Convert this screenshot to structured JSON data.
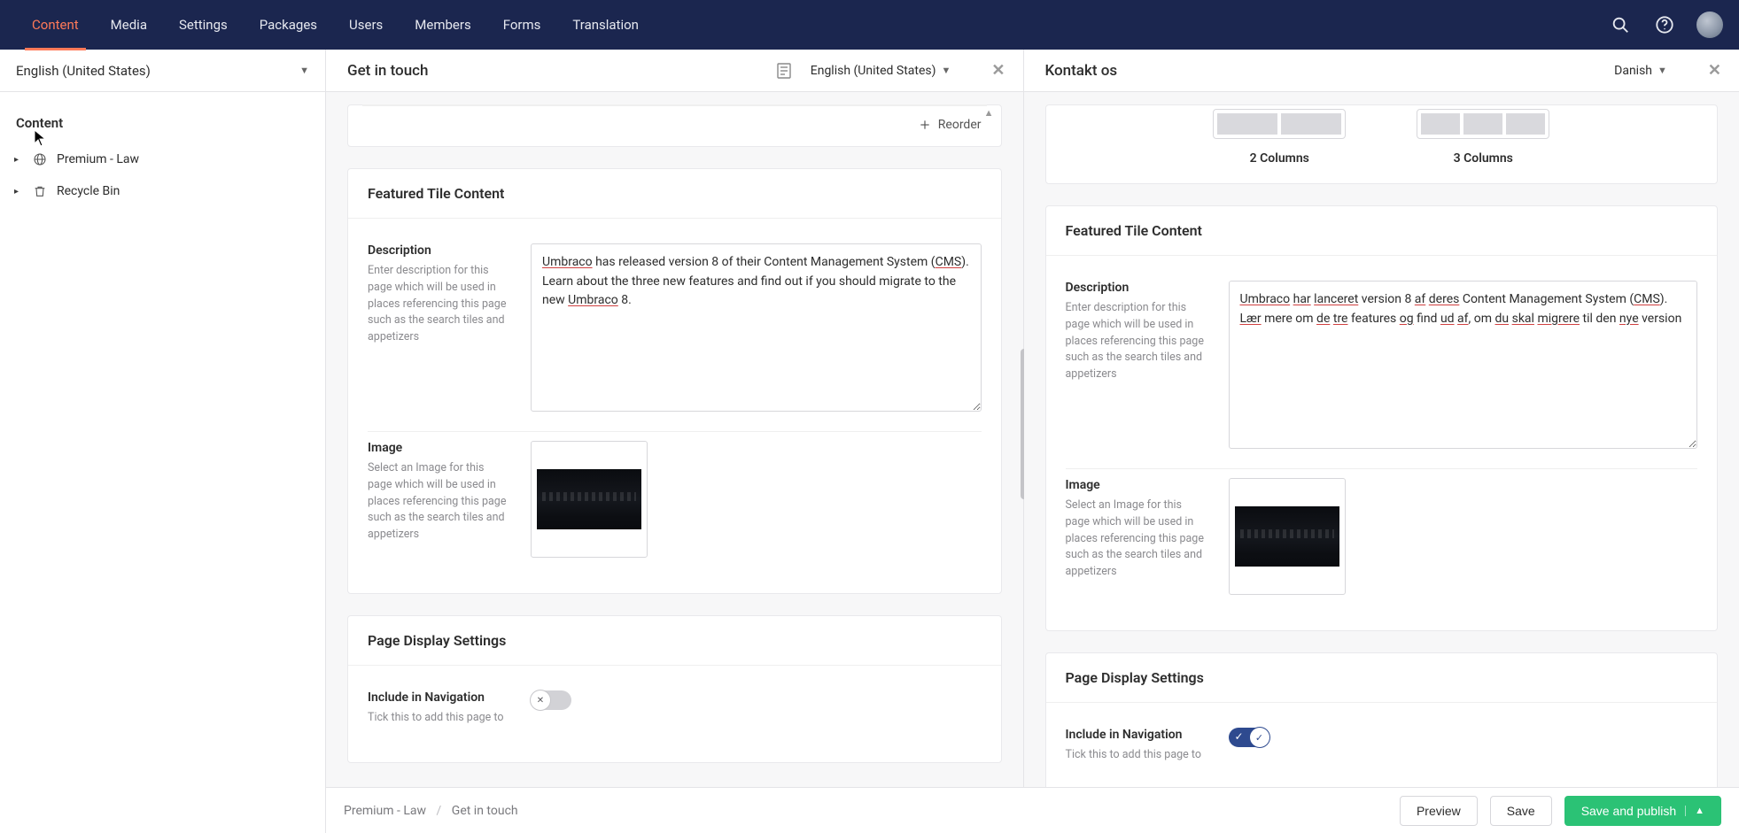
{
  "topnav": {
    "items": [
      "Content",
      "Media",
      "Settings",
      "Packages",
      "Users",
      "Members",
      "Forms",
      "Translation"
    ],
    "active_index": 0
  },
  "sidebar": {
    "language": "English (United States)",
    "section_label": "Content",
    "tree": [
      {
        "icon": "globe",
        "label": "Premium - Law"
      },
      {
        "icon": "trash",
        "label": "Recycle Bin"
      }
    ]
  },
  "panels": {
    "left": {
      "title": "Get in touch",
      "lang": "English (United States)",
      "reorder_label": "Reorder",
      "featured_tile_heading": "Featured Tile Content",
      "description": {
        "label": "Description",
        "help": "Enter description for this page which will be used in places referencing this page such as the search tiles and appetizers",
        "value_prefix1": "Umbraco",
        "value_mid1": " has released version 8 of their Content Management System (",
        "value_cms": "CMS",
        "value_mid2": "). Learn about the three new features and find out if you should migrate to the new ",
        "value_prefix2": "Umbraco",
        "value_suffix": " 8."
      },
      "image": {
        "label": "Image",
        "help": "Select an Image for this page which will be used in places referencing this page such as the search tiles and appetizers"
      },
      "page_display_heading": "Page Display Settings",
      "include_nav": {
        "label": "Include in Navigation",
        "help": "Tick this to add this page to",
        "value": false
      }
    },
    "right": {
      "title": "Kontakt os",
      "lang": "Danish",
      "layouts": [
        {
          "cols": 2,
          "label": "2 Columns"
        },
        {
          "cols": 3,
          "label": "3 Columns"
        }
      ],
      "featured_tile_heading": "Featured Tile Content",
      "description": {
        "label": "Description",
        "help": "Enter description for this page which will be used in places referencing this page such as the search tiles and appetizers",
        "segments": [
          {
            "t": "Umbraco",
            "u": true
          },
          {
            "t": " "
          },
          {
            "t": "har",
            "u": true
          },
          {
            "t": " "
          },
          {
            "t": "lanceret",
            "u": true
          },
          {
            "t": " version 8 "
          },
          {
            "t": "af",
            "u": true
          },
          {
            "t": " "
          },
          {
            "t": "deres",
            "u": true
          },
          {
            "t": " Content Management System ("
          },
          {
            "t": "CMS",
            "u": true
          },
          {
            "t": "). "
          },
          {
            "t": "Lær",
            "u": true
          },
          {
            "t": " mere om "
          },
          {
            "t": "de",
            "u": true
          },
          {
            "t": " "
          },
          {
            "t": "tre",
            "u": true
          },
          {
            "t": " features "
          },
          {
            "t": "og",
            "u": true
          },
          {
            "t": " find "
          },
          {
            "t": "ud",
            "u": true
          },
          {
            "t": " "
          },
          {
            "t": "af",
            "u": true
          },
          {
            "t": ", om "
          },
          {
            "t": "du",
            "u": true
          },
          {
            "t": " "
          },
          {
            "t": "skal",
            "u": true
          },
          {
            "t": " "
          },
          {
            "t": "migrere",
            "u": true
          },
          {
            "t": " til den "
          },
          {
            "t": "nye",
            "u": true
          },
          {
            "t": " version"
          }
        ]
      },
      "image": {
        "label": "Image",
        "help": "Select an Image for this page which will be used in places referencing this page such as the search tiles and appetizers"
      },
      "page_display_heading": "Page Display Settings",
      "include_nav": {
        "label": "Include in Navigation",
        "help": "Tick this to add this page to",
        "value": true
      }
    }
  },
  "breadcrumb": {
    "root": "Premium - Law",
    "current": "Get in touch"
  },
  "buttons": {
    "preview": "Preview",
    "save": "Save",
    "publish": "Save and publish"
  }
}
